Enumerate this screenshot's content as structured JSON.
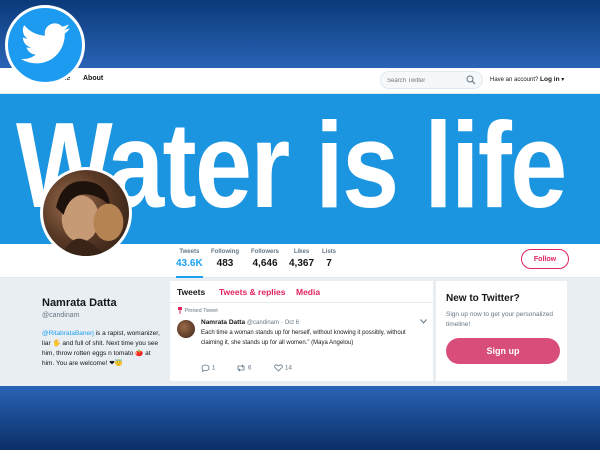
{
  "navbar": {
    "home_label": "ne",
    "about_label": "About",
    "search_placeholder": "Search Twitter",
    "account_prompt": "Have an account?",
    "login_label": "Log in"
  },
  "banner": {
    "text": "Water is life"
  },
  "stats": [
    {
      "label": "Tweets",
      "value": "43.6K"
    },
    {
      "label": "Following",
      "value": "483"
    },
    {
      "label": "Followers",
      "value": "4,646"
    },
    {
      "label": "Likes",
      "value": "4,367"
    },
    {
      "label": "Lists",
      "value": "7"
    }
  ],
  "follow_label": "Follow",
  "profile": {
    "name": "Namrata Datta",
    "handle": "@candinam",
    "bio_mention": "@RitabrataBanerj",
    "bio_part1": " is a rapist, womanizer, liar ",
    "bio_part2": " and full of shit. Next time you see him, throw rotten eggs n tomato ",
    "bio_part3": " at him. You are welcome! ",
    "bio_emoji_1": "🖐",
    "bio_emoji_2": "🍅",
    "bio_emoji_3": "❤😇"
  },
  "timeline": {
    "tabs": [
      "Tweets",
      "Tweets & replies",
      "Media"
    ],
    "pinned_label": "Pinned Tweet",
    "tweet": {
      "author": "Namrata Datta",
      "handle": "@candinam",
      "date": "Oct 6",
      "text": "Each time a woman stands up for herself, without knowing it possibly, without claiming it, she stands up for all women.\" (Maya Angelou)",
      "replies": "1",
      "retweets": "6",
      "likes": "14"
    }
  },
  "signup": {
    "title": "New to Twitter?",
    "description": "Sign up now to get your personalized timeline!",
    "button_label": "Sign up"
  },
  "colors": {
    "twitter_blue": "#1da1f2",
    "banner_blue": "#1b95e0",
    "accent_pink": "#e0245e",
    "signup_pink": "#d94d7a"
  }
}
